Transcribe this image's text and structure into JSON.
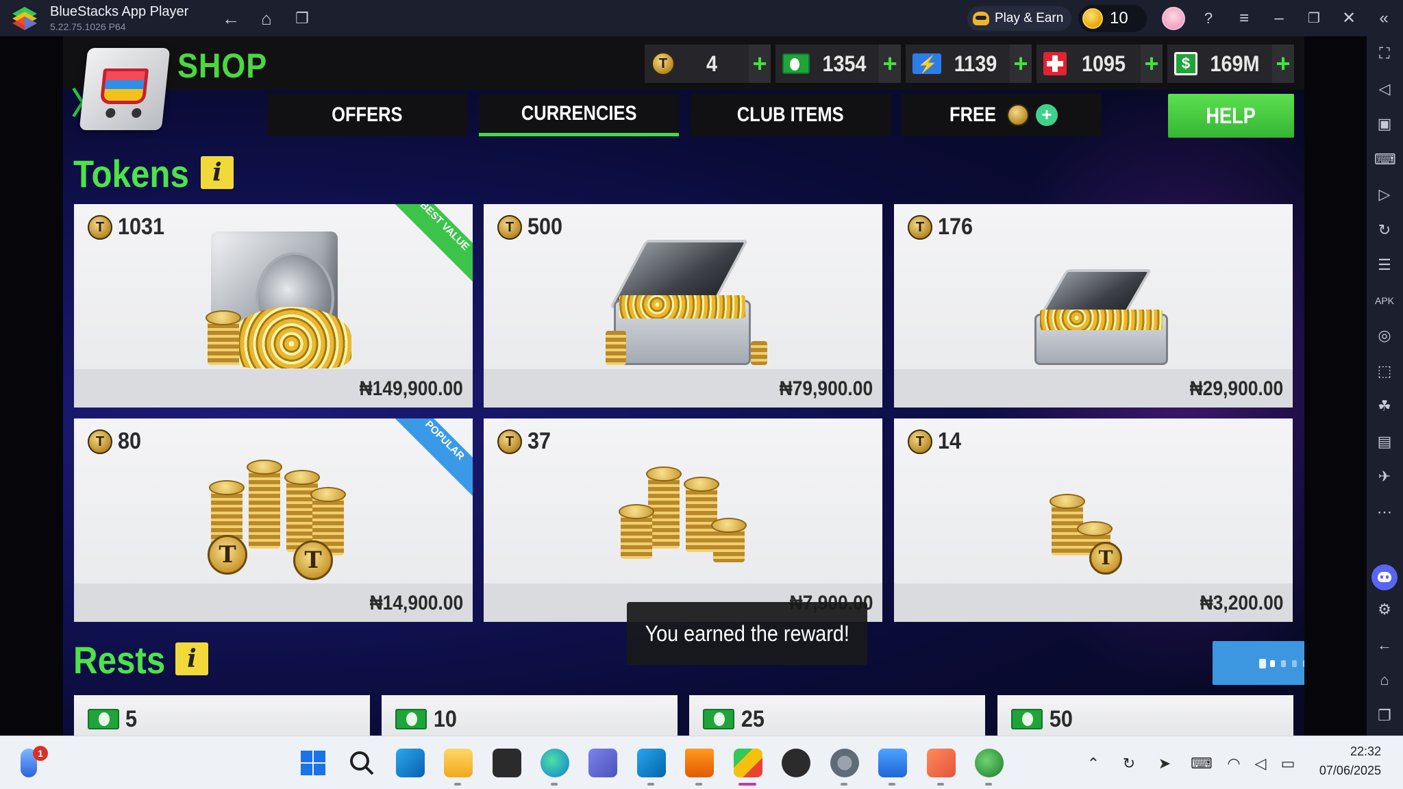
{
  "window": {
    "title": "BlueStacks App Player",
    "version": "5.22.75.1026 P64",
    "play_earn_label": "Play & Earn",
    "coins": "10",
    "nav": [
      "back-icon",
      "home-icon",
      "recent-apps-icon"
    ],
    "controls": [
      "help-icon",
      "menu-icon",
      "minimize-icon",
      "restore-icon",
      "close-icon",
      "collapse-sidebar-icon"
    ]
  },
  "sidebar": {
    "icons": [
      "fullscreen-icon",
      "volume-icon",
      "media-icon",
      "keyboard-controls-icon",
      "macro-icon",
      "rotate-icon",
      "multi-instance-icon",
      "install-apk-icon",
      "screenshot-icon",
      "record-icon",
      "eco-mode-icon",
      "media-folder-icon",
      "airplane-mode-icon",
      "more-icon",
      "discord-icon",
      "settings-icon",
      "back-icon",
      "home-icon",
      "recents-icon"
    ]
  },
  "game": {
    "shop_title": "SHOP",
    "currencies": [
      {
        "icon": "token-icon",
        "value": "4"
      },
      {
        "icon": "cash-icon",
        "value": "1354"
      },
      {
        "icon": "energy-icon",
        "value": "1139"
      },
      {
        "icon": "medkit-icon",
        "value": "1095"
      },
      {
        "icon": "money-icon",
        "value": "169M"
      }
    ],
    "tabs": [
      {
        "label": "OFFERS",
        "active": false
      },
      {
        "label": "CURRENCIES",
        "active": true
      },
      {
        "label": "CLUB ITEMS",
        "active": false
      },
      {
        "label": "FREE",
        "active": false
      }
    ],
    "help_label": "HELP",
    "tokens_title": "Tokens",
    "tokens_info": "i",
    "token_cards": [
      {
        "amount": "1031",
        "price": "₦149,900.00",
        "ribbon": "BEST VALUE"
      },
      {
        "amount": "500",
        "price": "₦79,900.00",
        "ribbon": ""
      },
      {
        "amount": "176",
        "price": "₦29,900.00",
        "ribbon": ""
      },
      {
        "amount": "80",
        "price": "₦14,900.00",
        "ribbon": "POPULAR"
      },
      {
        "amount": "37",
        "price": "₦7,900.00",
        "ribbon": ""
      },
      {
        "amount": "14",
        "price": "₦3,200.00",
        "ribbon": ""
      }
    ],
    "rests_title": "Rests",
    "rests_info": "i",
    "rest_cards": [
      "5",
      "10",
      "25",
      "50"
    ],
    "toast": "You earned the reward!",
    "colors": {
      "accent_green": "#4bd83f",
      "help_green": "#35b534",
      "loading_blue": "#3d97e0"
    }
  },
  "taskbar": {
    "weather_badge": "1",
    "apps": [
      "start-icon",
      "search-icon",
      "outlook-icon",
      "file-explorer-icon",
      "terminal-icon",
      "edge-icon",
      "teams-icon",
      "vscode-icon",
      "vlc-icon",
      "bluestacks-icon",
      "media-player-icon",
      "settings-icon",
      "notepad-icon",
      "snipping-icon",
      "globe-icon"
    ],
    "time": "22:32",
    "date": "07/06/2025"
  }
}
